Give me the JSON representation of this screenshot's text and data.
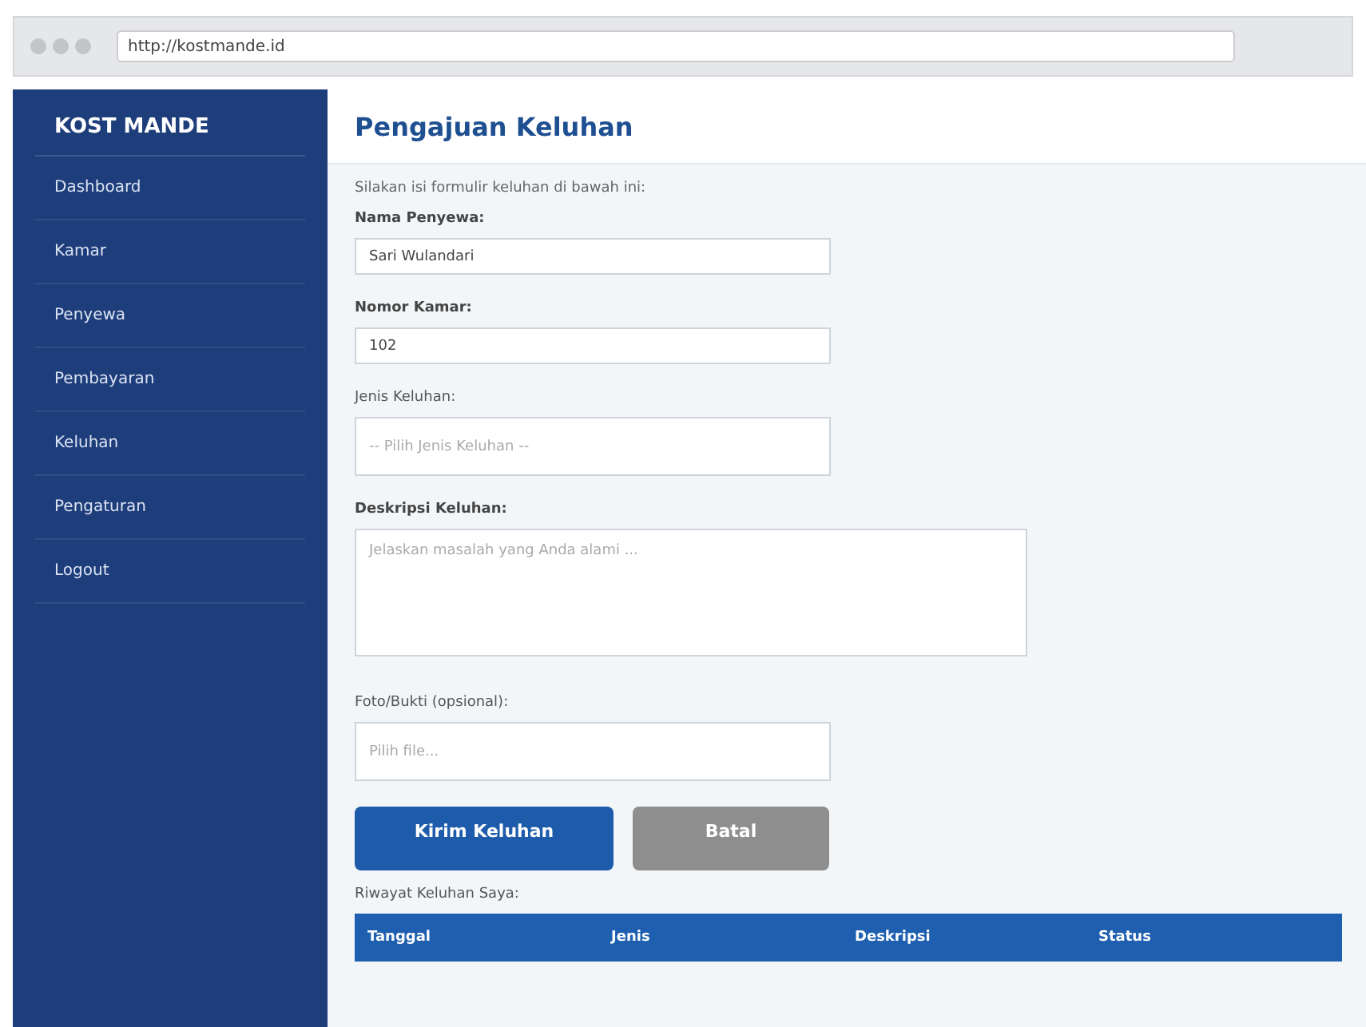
{
  "browser": {
    "url": "http://kostmande.id"
  },
  "sidebar": {
    "brand": "KOST MANDE",
    "items": [
      {
        "label": "Dashboard"
      },
      {
        "label": "Kamar"
      },
      {
        "label": "Penyewa"
      },
      {
        "label": "Pembayaran"
      },
      {
        "label": "Keluhan"
      },
      {
        "label": "Pengaturan"
      },
      {
        "label": "Logout"
      }
    ]
  },
  "page": {
    "title": "Pengajuan Keluhan",
    "intro": "Silakan isi formulir keluhan di bawah ini:"
  },
  "form": {
    "fields": [
      {
        "kind": "text",
        "label": "Nama Penyewa:",
        "label_bold": true,
        "value": "Sari Wulandari"
      },
      {
        "kind": "text",
        "label": "Nomor Kamar:",
        "label_bold": true,
        "value": "102"
      },
      {
        "kind": "select",
        "label": "Jenis Keluhan:",
        "label_bold": false,
        "placeholder": "-- Pilih Jenis Keluhan --"
      },
      {
        "kind": "textarea",
        "label": "Deskripsi Keluhan:",
        "label_bold": true,
        "placeholder": "Jelaskan masalah yang Anda alami ..."
      },
      {
        "kind": "file",
        "label": "Foto/Bukti (opsional):",
        "label_bold": false,
        "placeholder": "Pilih file..."
      }
    ],
    "buttons": [
      {
        "label": "Kirim Keluhan",
        "kind": "primary"
      },
      {
        "label": "Batal",
        "kind": "secondary"
      }
    ]
  },
  "history": {
    "title": "Riwayat Keluhan Saya:",
    "table": {
      "columns": [
        "Tanggal",
        "Jenis",
        "Deskripsi",
        "Status"
      ]
    }
  }
}
